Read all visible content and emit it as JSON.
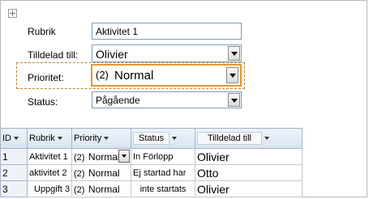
{
  "form": {
    "rubrik": {
      "label": "Rubrik",
      "value": "Aktivitet 1"
    },
    "tilldelad": {
      "label": "Tilldelad till:",
      "value": "Olivier"
    },
    "prioritet": {
      "label": "Prioritet:",
      "number": "(2)",
      "value": "Normal"
    },
    "status": {
      "label": "Status:",
      "value": "Pågående"
    }
  },
  "datasheet": {
    "headers": [
      "ID",
      "Rubrik",
      "Priority",
      "Status",
      "Tilldelad till"
    ],
    "rows": [
      {
        "id": "1",
        "rubrik": "Aktivitet 1",
        "prio_num": "(2)",
        "prio": "Normal",
        "status": "In  Förlopp",
        "assigned": "Olivier"
      },
      {
        "id": "2",
        "rubrik": "aktivitet 2",
        "prio_num": "(2)",
        "prio": "Normal",
        "status": "Ej startad har",
        "assigned": "Otto"
      },
      {
        "id": "3",
        "rubrik": "Uppgift 3",
        "prio_num": "(2)",
        "prio": "Normal",
        "status": "inte startats",
        "assigned": "Olivier"
      }
    ]
  }
}
